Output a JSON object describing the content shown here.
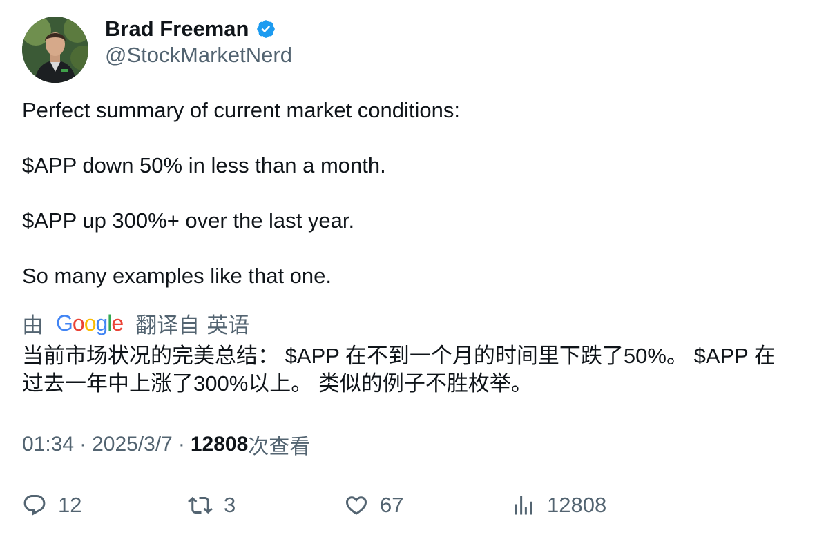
{
  "author": {
    "name": "Brad Freeman",
    "handle": "@StockMarketNerd",
    "verified": true,
    "badge_color": "#1d9bf0"
  },
  "tweet": {
    "lines": [
      "Perfect summary of current market conditions:",
      "$APP down 50% in less than a month.",
      "$APP up 300%+ over the last year.",
      "So many examples like that one."
    ]
  },
  "translation": {
    "prefix": "由",
    "service": "Google",
    "suffix": "翻译自",
    "language": "英语",
    "text_lines": [
      "当前市场状况的完美总结： $APP 在不到一个月的时间里下跌了50%。 $APP 在",
      "过去一年中上涨了300%以上。 类似的例子不胜枚举。"
    ]
  },
  "meta": {
    "time": "01:34",
    "date": "2025/3/7",
    "separator": "·",
    "views_count": "12808",
    "views_label": "次查看"
  },
  "actions": {
    "replies": "12",
    "retweets": "3",
    "likes": "67",
    "views": "12808"
  },
  "colors": {
    "text_primary": "#0f1419",
    "text_secondary": "#536471",
    "google_blue": "#4285f4",
    "google_red": "#ea4335",
    "google_yellow": "#fbbc05",
    "google_green": "#34a853"
  },
  "icons": {
    "reply": "reply-icon",
    "retweet": "retweet-icon",
    "like": "heart-icon",
    "views": "analytics-icon",
    "verified": "verified-badge-icon"
  }
}
